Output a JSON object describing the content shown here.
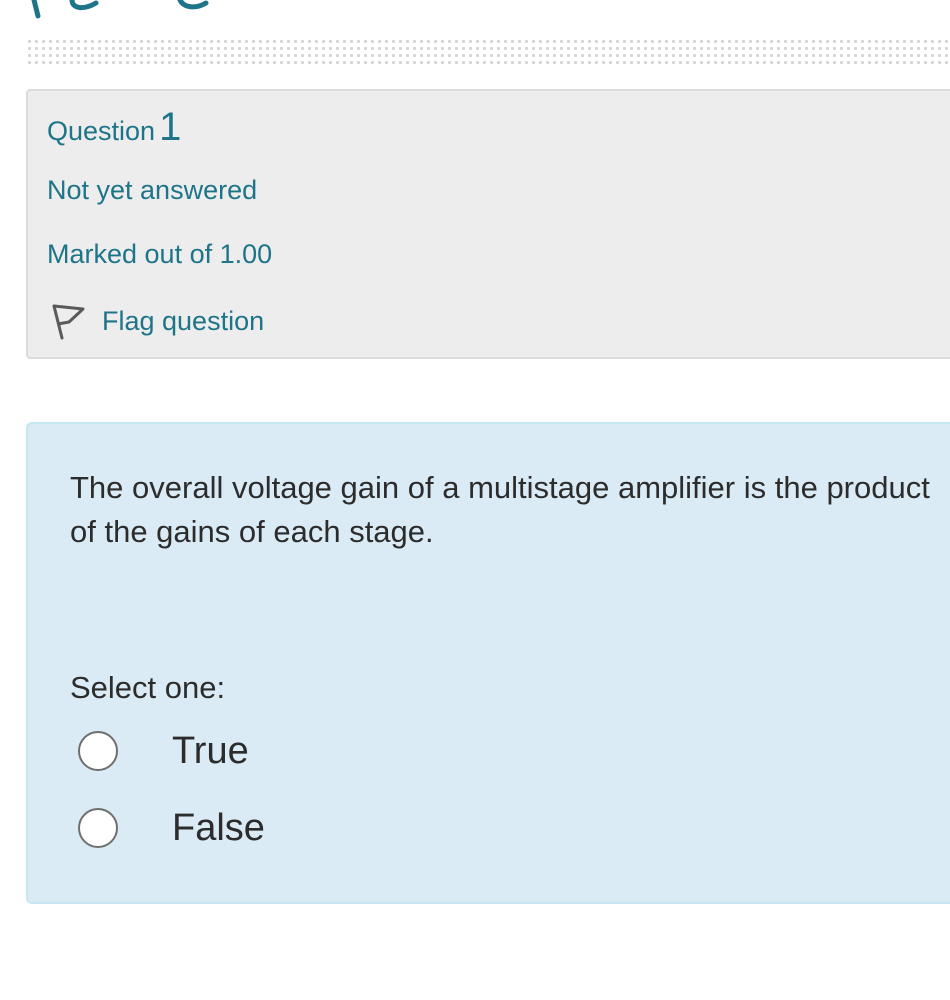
{
  "question": {
    "label": "Question",
    "number": "1",
    "state": "Not yet answered",
    "grade": "Marked out of 1.00",
    "flag_label": "Flag question",
    "flag_icon": "flag-icon",
    "text": "The overall voltage gain of a multistage amplifier is the product of the gains of each stage.",
    "prompt": "Select one:",
    "options": [
      {
        "label": "True",
        "selected": false
      },
      {
        "label": "False",
        "selected": false
      }
    ]
  },
  "colors": {
    "accent": "#1e7489",
    "info_background": "#ededed",
    "content_background": "#daebf5"
  }
}
